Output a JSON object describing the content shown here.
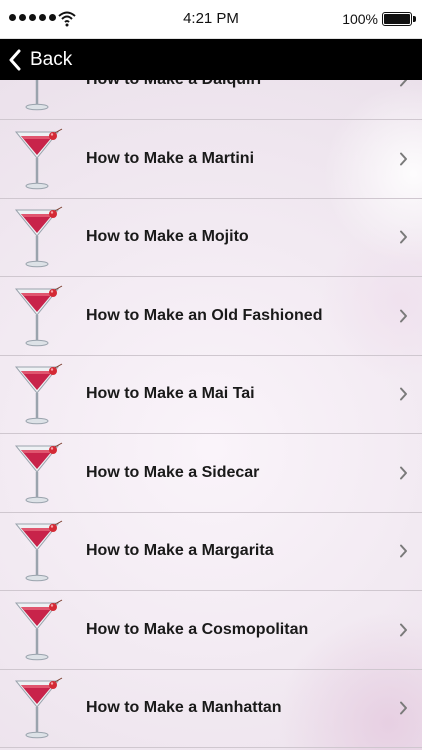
{
  "status_bar": {
    "time": "4:21 PM",
    "battery_percent": "100%",
    "signal_dots": 5
  },
  "nav": {
    "back_label": "Back"
  },
  "list": {
    "items": [
      {
        "label": "How to Make a Daiquiri",
        "icon": "martini-glass-icon"
      },
      {
        "label": "How to Make a Martini",
        "icon": "martini-glass-icon"
      },
      {
        "label": "How to Make a Mojito",
        "icon": "martini-glass-icon"
      },
      {
        "label": "How to Make an Old Fashioned",
        "icon": "martini-glass-icon"
      },
      {
        "label": "How to Make a Mai Tai",
        "icon": "martini-glass-icon"
      },
      {
        "label": "How to Make a Sidecar",
        "icon": "martini-glass-icon"
      },
      {
        "label": "How to Make a Margarita",
        "icon": "martini-glass-icon"
      },
      {
        "label": "How to Make a Cosmopolitan",
        "icon": "martini-glass-icon"
      },
      {
        "label": "How to Make a Manhattan",
        "icon": "martini-glass-icon"
      }
    ]
  },
  "colors": {
    "navbar_bg": "#000000",
    "drink": "#c8234a",
    "cherry": "#d42a35"
  }
}
